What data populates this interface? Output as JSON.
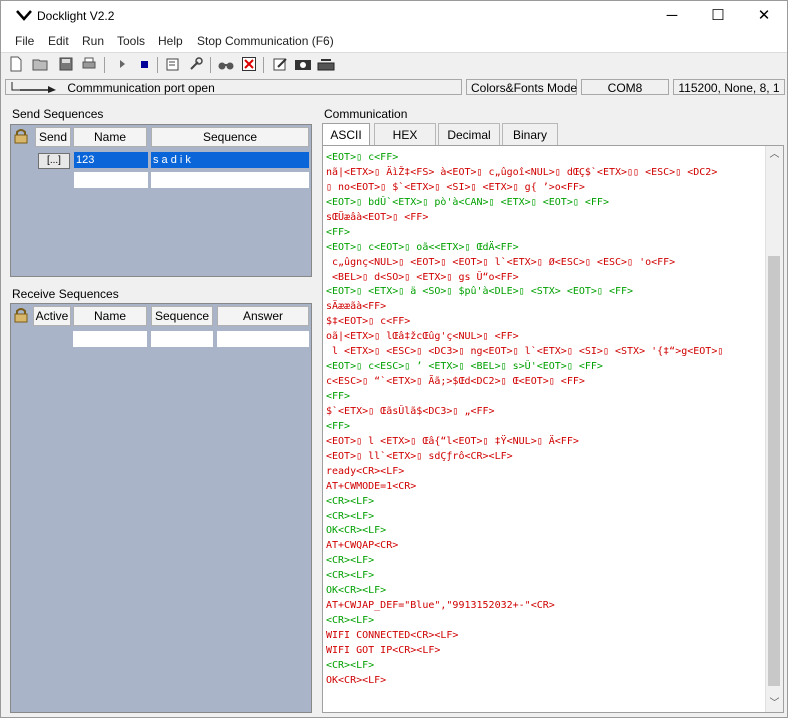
{
  "window": {
    "title": "Docklight V2.2",
    "minimize": "─",
    "maximize": "☐",
    "close": "✕"
  },
  "menu": [
    "File",
    "Edit",
    "Run",
    "Tools",
    "Help",
    "Stop Communication  (F6)"
  ],
  "status": {
    "message": "Commmunication port open",
    "mode": "Colors&Fonts Mode",
    "port": "COM8",
    "settings": "115200, None, 8, 1"
  },
  "send_sequences": {
    "label": "Send Sequences",
    "headers": [
      "Send",
      "Name",
      "Sequence"
    ],
    "rows": [
      {
        "button": "[...]",
        "name": "123",
        "sequence": "s a d i k"
      }
    ]
  },
  "receive_sequences": {
    "label": "Receive Sequences",
    "headers": [
      "Active",
      "Name",
      "Sequence",
      "Answer"
    ]
  },
  "communication": {
    "label": "Communication",
    "tabs": [
      "ASCII",
      "HEX",
      "Decimal",
      "Binary"
    ],
    "active_tab": "ASCII",
    "colors": {
      "red": "#d00000",
      "green": "#00a000"
    },
    "lines": [
      {
        "c": "green",
        "t": "<EOT>▯ c<FF>"
      },
      {
        "c": "red",
        "t": "nã|<ETX>▯ ÄìŽ‡<FS> à<EOT>▯ c„ûgoî<NUL>▯ dŒÇ$`<ETX>▯▯ <ESC>▯ <DC2>"
      },
      {
        "c": "red",
        "t": "▯ no<EOT>▯ $`<ETX>▯ <SI>▯ <ETX>▯ g{ ’>o<FF>"
      },
      {
        "c": "green",
        "t": "<EOT>▯ bdÛ`<ETX>▯ pò'à<CAN>▯ <ETX>▯ <EOT>▯ <FF>"
      },
      {
        "c": "red",
        "t": "sŒÜæâà<EOT>▯ <FF>"
      },
      {
        "c": "green",
        "t": "<FF>"
      },
      {
        "c": "green",
        "t": "<EOT>▯ c<EOT>▯ oã<<ETX>▯ ŒdÄ<FF>"
      },
      {
        "c": "red",
        "t": " c„ûgnç<NUL>▯ <EOT>▯ <EOT>▯ l`<ETX>▯ Ø<ESC>▯ <ESC>▯ 'o<FF>"
      },
      {
        "c": "red",
        "t": " <BEL>▯ d<SO>▯ <ETX>▯ gs Û“o<FF>"
      },
      {
        "c": "green",
        "t": "<EOT>▯ <ETX>▯ ä <SO>▯ $pû'à<DLE>▯ <STX> <EOT>▯ <FF>"
      },
      {
        "c": "red",
        "t": "sÄææãà<FF>"
      },
      {
        "c": "red",
        "t": "$‡<EOT>▯ c<FF>"
      },
      {
        "c": "red",
        "t": "oã|<ETX>▯ lŒâ‡žcŒûg'ç<NUL>▯ <FF>"
      },
      {
        "c": "red",
        "t": " l <ETX>▯ <ESC>▯ <DC3>▯ ng<EOT>▯ l`<ETX>▯ <SI>▯ <STX> '{‡“>g<EOT>▯"
      },
      {
        "c": "green",
        "t": "<EOT>▯ c<ESC>▯ ’ <ETX>▯ <BEL>▯ s>Û'<EOT>▯ <FF>"
      },
      {
        "c": "red",
        "t": "c<ESC>▯ “`<ETX>▯ Ãã;>$Œd<DC2>▯ Œ<EOT>▯ <FF>"
      },
      {
        "c": "green",
        "t": "<FF>"
      },
      {
        "c": "red",
        "t": "$`<ETX>▯ ŒãsÛlã$<DC3>▯ „<FF>"
      },
      {
        "c": "green",
        "t": "<FF>"
      },
      {
        "c": "red",
        "t": "<EOT>▯ l <ETX>▯ Œâ{“l<EOT>▯ ‡Ÿ<NUL>▯ Ä<FF>"
      },
      {
        "c": "red",
        "t": "<EOT>▯ ll`<ETX>▯ sdÇƒrô<CR><LF>"
      },
      {
        "c": "red",
        "t": "ready<CR><LF>"
      },
      {
        "c": "red",
        "t": "AT+CWMODE=1<CR>"
      },
      {
        "c": "green",
        "t": "<CR><LF>"
      },
      {
        "c": "green",
        "t": "<CR><LF>"
      },
      {
        "c": "green",
        "t": "OK<CR><LF>"
      },
      {
        "c": "red",
        "t": "AT+CWQAP<CR>"
      },
      {
        "c": "green",
        "t": "<CR><LF>"
      },
      {
        "c": "green",
        "t": "<CR><LF>"
      },
      {
        "c": "green",
        "t": "OK<CR><LF>"
      },
      {
        "c": "red",
        "t": "AT+CWJAP_DEF=\"Blue\",\"9913152032+-\"<CR>"
      },
      {
        "c": "green",
        "t": "<CR><LF>"
      },
      {
        "c": "red",
        "t": "WIFI CONNECTED<CR><LF>"
      },
      {
        "c": "red",
        "t": "WIFI GOT IP<CR><LF>"
      },
      {
        "c": "green",
        "t": "<CR><LF>"
      },
      {
        "c": "red",
        "t": "OK<CR><LF>"
      }
    ]
  }
}
